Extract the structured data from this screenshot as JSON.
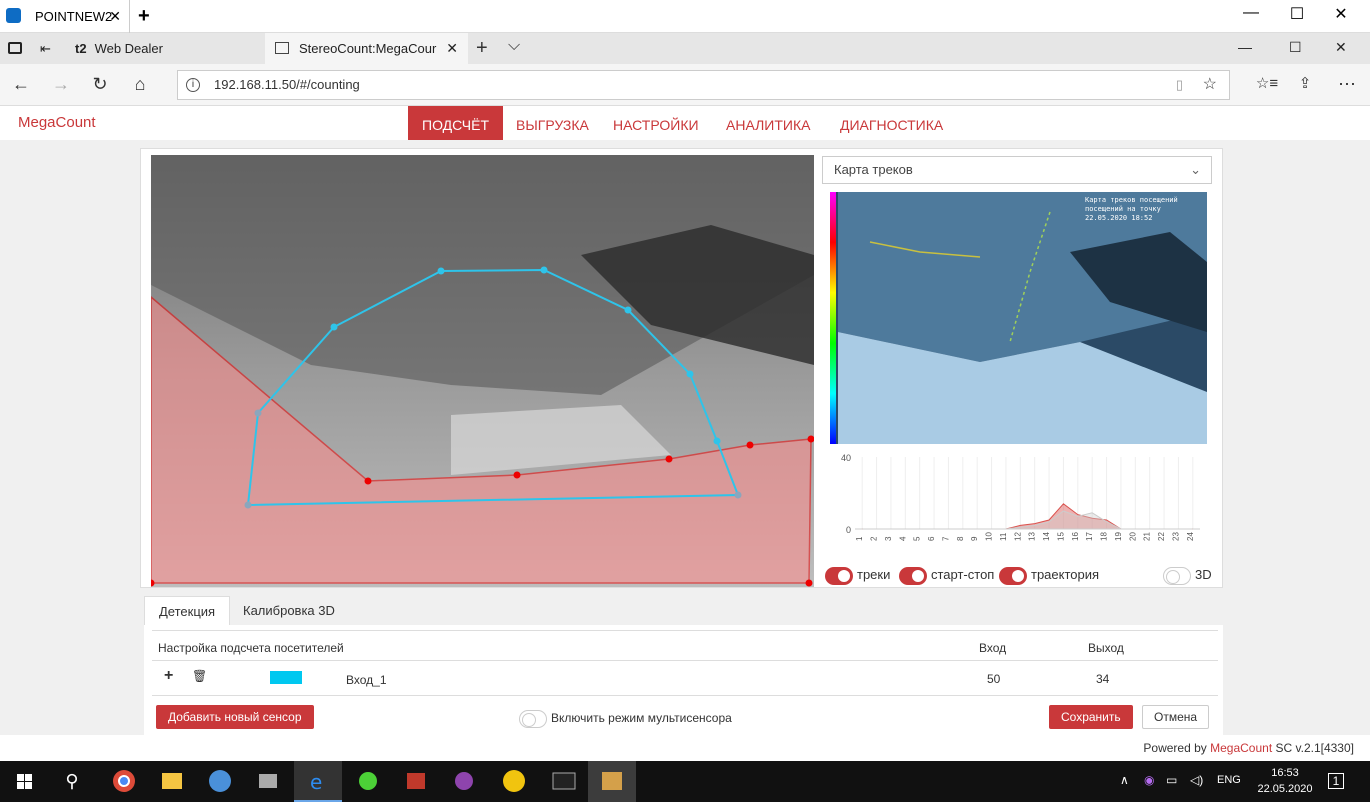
{
  "remote": {
    "tab_title": "POINTNEW2",
    "close": "✕",
    "new_tab": "+"
  },
  "window_controls": {
    "minimize": "—",
    "maximize": "☐",
    "close": "✕"
  },
  "browser": {
    "tabs": [
      {
        "label": "Web Dealer",
        "badge": "t2"
      },
      {
        "label": "StereoCount:MegaCour",
        "close": "✕"
      }
    ],
    "new_tab": "+",
    "tab_list": "⌵",
    "url": "192.168.11.50/#/counting"
  },
  "app": {
    "brand": "MegaCount",
    "nav": [
      {
        "label": "ПОДСЧЁТ",
        "active": true
      },
      {
        "label": "ВЫГРУЗКА",
        "active": false
      },
      {
        "label": "НАСТРОЙКИ",
        "active": false
      },
      {
        "label": "АНАЛИТИКА",
        "active": false
      },
      {
        "label": "ДИАГНОСТИКА",
        "active": false
      }
    ]
  },
  "viewer": {
    "dropdown_value": "Карта треков",
    "heatmap_caption": "Карта треков посещений\nпосещений на точку\n22.05.2020 18:52",
    "toggles": [
      {
        "label": "треки",
        "on": true
      },
      {
        "label": "старт-стоп",
        "on": true
      },
      {
        "label": "траектория",
        "on": true
      },
      {
        "label": "3D",
        "on": false
      }
    ]
  },
  "chart_data": {
    "type": "area",
    "x": [
      "1",
      "2",
      "3",
      "4",
      "5",
      "6",
      "7",
      "8",
      "9",
      "10",
      "11",
      "12",
      "13",
      "14",
      "15",
      "16",
      "17",
      "18",
      "19",
      "20",
      "21",
      "22",
      "23",
      "24"
    ],
    "y_ticks": [
      "40",
      "0"
    ],
    "ylim": [
      0,
      40
    ],
    "series": [
      {
        "values": [
          0,
          0,
          0,
          0,
          0,
          0,
          0,
          0,
          0,
          0,
          0,
          2,
          3,
          5,
          14,
          8,
          6,
          5,
          0,
          0,
          0,
          0,
          0,
          0
        ]
      },
      {
        "values": [
          0,
          0,
          0,
          0,
          0,
          0,
          0,
          0,
          0,
          0,
          0,
          1,
          2,
          4,
          10,
          7,
          9,
          4,
          0,
          0,
          0,
          0,
          0,
          0
        ]
      }
    ],
    "colors": {
      "series1": "#d9534f",
      "series2": "#cccccc"
    }
  },
  "lower_tabs": [
    {
      "label": "Детекция",
      "active": true
    },
    {
      "label": "Калибровка 3D",
      "active": false
    }
  ],
  "settings": {
    "title": "Настройка подсчета посетителей",
    "col_in": "Вход",
    "col_out": "Выход",
    "rows": [
      {
        "name": "Вход_1",
        "in": "50",
        "out": "34",
        "color": "#00c8f0"
      }
    ],
    "add_sensor": "Добавить новый сенсор",
    "multisensor": "Включить режим мультисенсора",
    "save": "Сохранить",
    "cancel": "Отмена",
    "add_icon": "+",
    "delete_icon": "🗑"
  },
  "footer": {
    "powered_by": "Powered by",
    "product": "MegaCount",
    "version": "SC v.2.1[4330]"
  },
  "taskbar": {
    "lang": "ENG",
    "time": "16:53",
    "date": "22.05.2020",
    "notifications": "1"
  }
}
